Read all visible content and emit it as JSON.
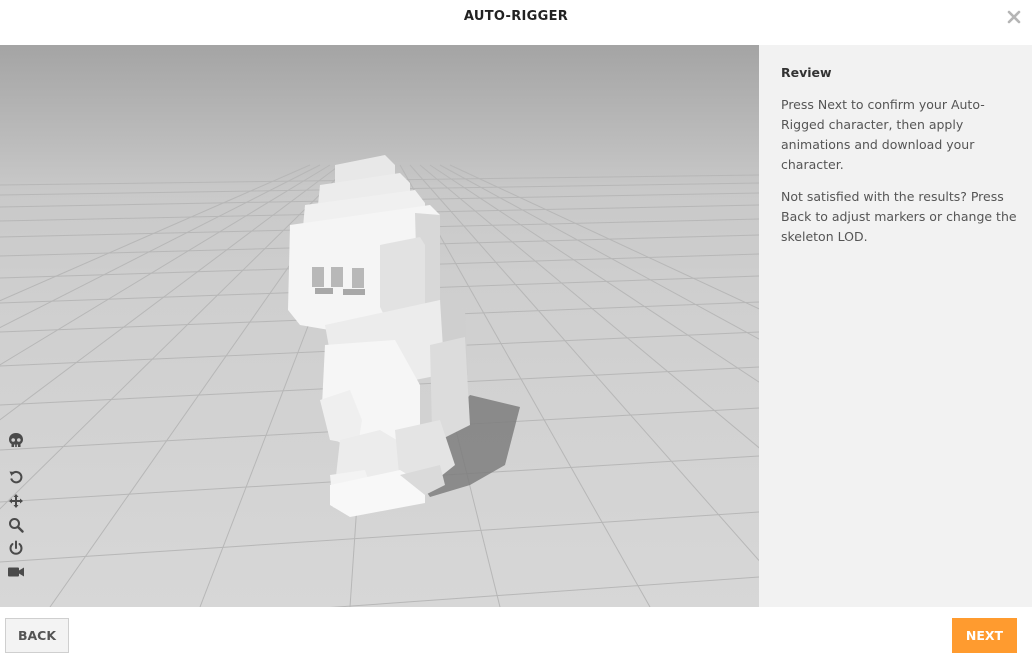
{
  "dialog": {
    "title": "AUTO-RIGGER",
    "close_icon": "close-icon"
  },
  "viewport": {
    "description_icons": [
      "skull-icon",
      "undo-icon",
      "move-icon",
      "zoom-icon",
      "power-icon",
      "camera-icon"
    ]
  },
  "panel": {
    "heading": "Review",
    "paragraph_1": "Press Next to confirm your Auto-Rigged character, then apply animations and download your character.",
    "paragraph_2": "Not satisfied with the results? Press Back to adjust markers or change the skeleton LOD."
  },
  "footer": {
    "back_label": "BACK",
    "next_label": "NEXT"
  },
  "colors": {
    "accent": "#ff9b2f",
    "panel_bg": "#f2f2f2"
  }
}
